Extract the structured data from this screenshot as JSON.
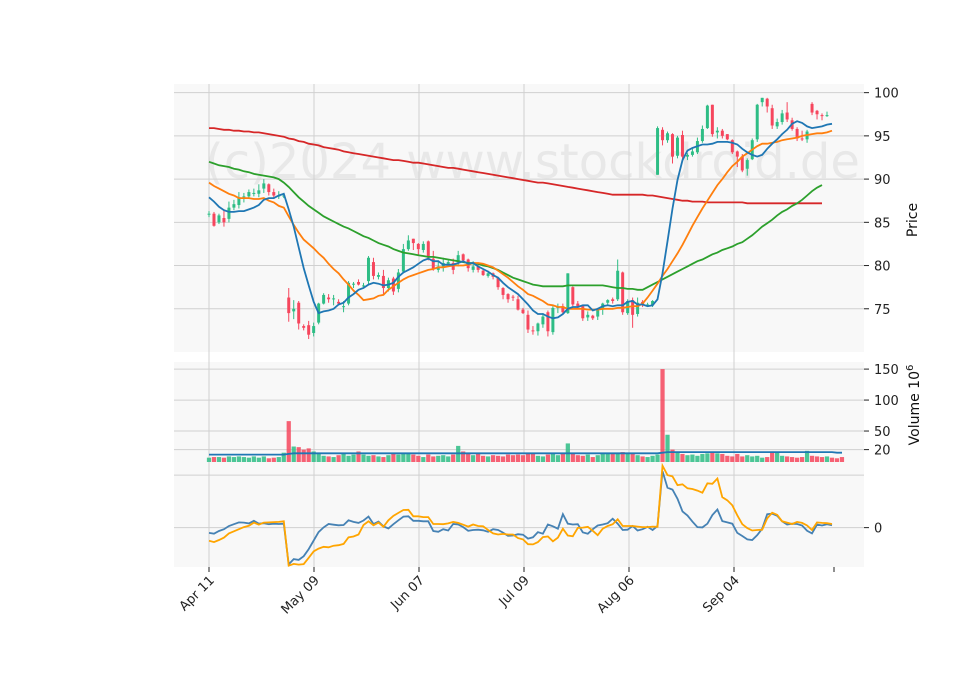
{
  "watermark": "(c)2024 www.stockdroid.de",
  "colors": {
    "up": "#2ebd85",
    "down": "#f6465d",
    "ma_fast": "#1f77b4",
    "ma_mid": "#ff7f0e",
    "ma_slow": "#2ca02c",
    "ma_long": "#d62728",
    "osc_a": "#4682b4",
    "osc_b": "#ffa500",
    "grid": "#d0d0d0",
    "panel_bg": "#f8f8f8"
  },
  "chart_data": {
    "type": "candlestick",
    "x_ticks": [
      "Apr 11",
      "May 09",
      "Jun 07",
      "Jul 09",
      "Aug 06",
      "Sep 04"
    ],
    "price_panel": {
      "ylabel": "Price",
      "ylim": [
        70,
        101
      ],
      "yticks": [
        75,
        80,
        85,
        90,
        95,
        100
      ],
      "candles_compact": "86,86,85.6,86.3|86,84.6,84.5,86.2|85,85.8,84.8,86|85.5,85,84.5,86.5|85.4,86.7,85,87.4|86.7,87.1,86.4,87.6|87,87.9,86.6,88.5|87.9,88,87.3,88.4|88,88.5,87.7,88.8|88.4,88.4,88,88.9|88.3,88.7,87.9,89.4|88.9,89.5,88.4,90|89.4,88.5,88.1,89.5|88.5,88.1,87.8,88.9|88.1,88.1,87.7,88.6|88.1,88.1,87.8,88.4|76.3,74.5,73.5,77.4|74.7,75,73.8,76|75.7,73.3,72.6,75.9|73,72.8,72.5,73.2|73.1,72,71.5,73.6|72.2,73,71.8,73.4|73.4,75.6,73.2,75.7|75.6,76.6,75.5,76.8|76.3,76.1,75.7,76.7|76.1,76.2,75.4,76.6|75.8,75.6,75.4,76.1|75.3,75.3,74.6,75.9|75.6,78,75.4,78.2|77.8,77.9,77.4,78.1|78.1,77.8,77.7,78.4|77.6,77.7,77.5,78|78.2,80.9,77.7,81.1|80.4,78.8,78.4,80.9|78.7,78.9,78.4,79.2|78.8,77.4,76.6,79.5|77.4,78.3,77,78.6|78.5,77,76.6,78.7|77.3,79.2,76.9,79.6|79.3,81.9,79.1,82.5|81.9,82.9,81.7,83.5|83.1,82.6,81.8,83.1|82.5,81.9,81.1,82.6|81.8,82.5,81.5,82.8|82.8,80.9,80.6,82.9|80.8,79.6,79.4,81.7|79.5,79.9,79.2,80.6|79.9,80.3,79.3,80.9|80.2,80.4,79.9,80.6|80.3,79.5,79,80.8|80.4,81.2,79.9,81.7|81.3,80.6,80.4,81.4|80.7,79.7,79.3,80.8|79.5,79.9,79.2,80.5|79.9,79.5,79.2,80.3|79.4,78.9,78.8,79.6|78.8,79.1,78.6,79.4|79.1,78.7,78.4,79.2|78.6,77.5,77.2,78.7|77.4,76.6,76.1,77.5|76.7,76.1,75.7,76.8|76.4,76.3,75.9,76.6|76.1,74.9,74.8,76.5|74.9,74.5,74.4,75.1|74.3,72.6,72.2,74.8|72.5,72.4,72,73|72.4,73.3,71.9,73.4|73.2,74.1,72.8,74.5|74.6,72.4,71.8,74.8|72.3,75.1,72,75.3|75.1,75.2,74.5,75.6|75.3,74.6,74.4,75.6|74.5,79.1,74.4,79.1|77.5,75.5,75.3,77.6|75.6,75.3,75,75.9|75.3,73.9,73.6,75.4|74,74.3,73.6,74.7|74.2,73.9,73.7,74.3|74.1,74.9,73.7,75.1|74.9,75.6,74.3,75.7|75.7,76,75.5,76.1|76.1,75.9,75.6,76.3|76.1,79.4,75.9,80.7|79.2,74.6,74.3,79.3|74.5,75.9,74.3,76.1|76,74.3,72.8,76.3|74.4,75.7,74.1,76.3|75.8,75.5,75.2,76|75.5,75.5,75.3,75.7|75.4,75.9,75.2,76|90.5,95.9,90.5,96.1|95.7,94.5,93.9,96|94.5,95.3,94.2,95.5|95.2,92.6,91.8,95.3|92.7,94.8,92.4,95|95.1,92.6,92.2,95.6|92.6,92.8,92.2,93|92.8,93.2,92.6,93.5|93.1,94.4,92.9,94.8|94.4,95.8,94.2,96.2|95.9,98.5,95.8,98.6|98.6,95.2,94.9,98.6|95.4,95.6,94.7,96|95.6,95,94.7,95.8|95.2,94.6,94.5,95.2|94.5,93.1,92.9,94.6|93.2,92.6,91.4,93.3|92.6,91,90.8,92.9|91.2,92.2,90.4,92.4|92.3,94.5,92.2,94.7|94.6,98.6,94.3,98.7|98.9,99.4,98.4,99.4|99.3,98.4,97.7,99.4|98.2,96.2,95.8,98.6|96.1,96.6,95.8,97|96.6,97.6,96.3,98|97.7,96.9,96.6,98.9|96.8,95.8,95.6,97.1|95.8,94.7,94.4,96|94.7,94.6,94.4,95.6|94.6,95.5,94.2,95.7|98.7,97.7,97.4,98.9|97.9,97.5,96.9,98|97.4,97.3,96.8,97.6|97.3,97.4,97.2,97.8",
      "ma_fast": [
        87.9,
        87.4,
        86.8,
        86.4,
        86.2,
        86.2,
        86.3,
        86.3,
        86.5,
        86.7,
        87,
        87.6,
        87.8,
        87.8,
        88.1,
        88.3,
        86.5,
        84.5,
        82.1,
        79.7,
        77.7,
        75.8,
        74.5,
        74.7,
        74.8,
        75,
        75.5,
        75.7,
        76.3,
        76.7,
        77.2,
        77.4,
        77.8,
        78,
        77.9,
        77.7,
        77.8,
        78,
        78.7,
        79.2,
        79.5,
        79.8,
        80.2,
        80.6,
        80.8,
        80.5,
        80.5,
        80.1,
        80.1,
        80.1,
        80.3,
        80.5,
        80.2,
        80.3,
        79.9,
        79.6,
        79.3,
        78.9,
        78.6,
        78,
        77.5,
        77.1,
        76.7,
        76.1,
        75.5,
        74.8,
        74.4,
        74.4,
        74.1,
        73.9,
        74,
        74.4,
        75,
        75.2,
        75.2,
        75.4,
        75.4,
        74.8,
        75,
        75.3,
        75.4,
        75.3,
        75.4,
        75.4,
        75.8,
        75.9,
        75.5,
        75.5,
        75.3,
        75.4,
        76.1,
        79.1,
        82.8,
        86.6,
        89.9,
        92.2,
        93.3,
        93.6,
        93.8,
        94,
        94,
        94.1,
        94.3,
        94.3,
        94.3,
        94.2,
        94,
        93.5,
        93.1,
        92.8,
        92.6,
        92.8,
        93.5,
        94.1,
        94.6,
        95.2,
        95.7,
        96.4,
        96.7,
        96.5,
        96.1,
        95.9,
        96,
        96.1,
        96.3,
        96.4
      ],
      "ma_mid": [
        89.6,
        89.2,
        88.9,
        88.6,
        88.3,
        88.1,
        87.8,
        87.8,
        87.8,
        87.7,
        87.7,
        87.8,
        87.5,
        87.3,
        86.9,
        86.7,
        85.7,
        84.7,
        83.8,
        83,
        82.5,
        82,
        81.4,
        80.9,
        80.2,
        79.6,
        79.1,
        78.4,
        77.8,
        77.1,
        76.6,
        76,
        76.1,
        76.2,
        76.5,
        76.6,
        77.2,
        77.6,
        78,
        78.4,
        78.7,
        78.9,
        79.1,
        79.3,
        79.5,
        79.6,
        79.8,
        79.8,
        79.9,
        80,
        80,
        80,
        80.1,
        80.3,
        80.3,
        80.2,
        80,
        79.8,
        79.4,
        79,
        78.6,
        78.1,
        77.6,
        77.2,
        76.7,
        76.5,
        76.2,
        75.9,
        75.5,
        75.4,
        75.2,
        75.2,
        75,
        75,
        75,
        75,
        74.9,
        74.9,
        74.9,
        75,
        75,
        75,
        75.1,
        75.1,
        75.2,
        75.3,
        75.3,
        75.6,
        76.3,
        77.1,
        77.9,
        78.8,
        79.6,
        80.5,
        81.4,
        82.4,
        83.5,
        84.6,
        85.6,
        86.6,
        87.5,
        88.4,
        89.3,
        90,
        90.8,
        91.5,
        92,
        92.6,
        93,
        93.4,
        93.8,
        94.1,
        94.1,
        94.2,
        94.3,
        94.5,
        94.6,
        94.7,
        94.8,
        95,
        95.1,
        95.2,
        95.3,
        95.3,
        95.4,
        95.6
      ],
      "ma_slow": [
        92,
        91.8,
        91.6,
        91.5,
        91.4,
        91.2,
        91.1,
        90.9,
        90.8,
        90.6,
        90.5,
        90.4,
        90.3,
        90.2,
        90,
        89.6,
        89.1,
        88.5,
        87.9,
        87.4,
        86.9,
        86.5,
        86.1,
        85.7,
        85.4,
        85.1,
        84.8,
        84.5,
        84.3,
        84,
        83.7,
        83.4,
        83.2,
        82.9,
        82.6,
        82.4,
        82.2,
        81.9,
        81.7,
        81.5,
        81.4,
        81.3,
        81.2,
        81.1,
        81,
        81,
        80.9,
        80.8,
        80.7,
        80.6,
        80.5,
        80.4,
        80.3,
        80.3,
        80.2,
        80,
        79.9,
        79.7,
        79.5,
        79.2,
        78.9,
        78.6,
        78.4,
        78.2,
        78,
        77.8,
        77.7,
        77.6,
        77.6,
        77.6,
        77.6,
        77.6,
        77.7,
        77.7,
        77.7,
        77.7,
        77.7,
        77.7,
        77.7,
        77.7,
        77.6,
        77.5,
        77.4,
        77.4,
        77.3,
        77.3,
        77.2,
        77.2,
        77.5,
        77.8,
        78.1,
        78.4,
        78.7,
        79,
        79.3,
        79.6,
        79.9,
        80.2,
        80.5,
        80.7,
        81,
        81.3,
        81.5,
        81.8,
        82,
        82.2,
        82.5,
        82.7,
        83.1,
        83.5,
        84,
        84.5,
        84.9,
        85.3,
        85.8,
        86.2,
        86.5,
        86.9,
        87.2,
        87.6,
        88.1,
        88.6,
        89,
        89.3
      ],
      "ma_long": [
        95.9,
        95.9,
        95.8,
        95.7,
        95.7,
        95.6,
        95.6,
        95.5,
        95.5,
        95.4,
        95.4,
        95.3,
        95.2,
        95.1,
        95,
        94.9,
        94.7,
        94.6,
        94.4,
        94.3,
        94.1,
        94,
        93.9,
        93.7,
        93.6,
        93.5,
        93.4,
        93.2,
        93.1,
        93,
        92.9,
        92.8,
        92.7,
        92.6,
        92.5,
        92.4,
        92.3,
        92.2,
        92.2,
        92.1,
        92,
        91.9,
        91.9,
        91.8,
        91.7,
        91.6,
        91.5,
        91.4,
        91.3,
        91.3,
        91.2,
        91.1,
        91,
        90.9,
        90.8,
        90.7,
        90.6,
        90.5,
        90.4,
        90.3,
        90.2,
        90.1,
        90,
        89.9,
        89.8,
        89.7,
        89.6,
        89.6,
        89.5,
        89.4,
        89.3,
        89.2,
        89.1,
        89,
        88.9,
        88.8,
        88.7,
        88.6,
        88.5,
        88.4,
        88.3,
        88.2,
        88.2,
        88.2,
        88.2,
        88.2,
        88.2,
        88.2,
        88.1,
        88.1,
        88,
        87.9,
        87.8,
        87.7,
        87.6,
        87.5,
        87.5,
        87.4,
        87.4,
        87.4,
        87.3,
        87.3,
        87.3,
        87.3,
        87.3,
        87.3,
        87.3,
        87.3,
        87.2,
        87.2,
        87.2,
        87.2,
        87.2,
        87.2,
        87.2,
        87.2,
        87.2,
        87.2,
        87.2,
        87.2,
        87.2,
        87.2,
        87.2,
        87.2
      ]
    },
    "volume_panel": {
      "ylabel": "Volume  10^6",
      "ylim": [
        0,
        155
      ],
      "yticks": [
        20,
        50,
        100,
        150
      ],
      "volumes": [
        7,
        8,
        8,
        7,
        9,
        8,
        9,
        8,
        7,
        9,
        7,
        9,
        6,
        7,
        8,
        15,
        66,
        25,
        24,
        20,
        22,
        17,
        13,
        10,
        9,
        8,
        11,
        13,
        10,
        12,
        17,
        12,
        10,
        11,
        9,
        8,
        11,
        13,
        12,
        13,
        14,
        12,
        10,
        8,
        12,
        9,
        10,
        11,
        9,
        12,
        26,
        17,
        14,
        11,
        13,
        10,
        9,
        11,
        10,
        9,
        12,
        11,
        12,
        11,
        13,
        15,
        10,
        9,
        12,
        13,
        11,
        14,
        30,
        15,
        11,
        10,
        12,
        8,
        11,
        14,
        13,
        14,
        15,
        16,
        13,
        14,
        11,
        9,
        8,
        10,
        12,
        150,
        44,
        20,
        16,
        13,
        11,
        12,
        10,
        13,
        14,
        16,
        14,
        13,
        10,
        9,
        13,
        9,
        11,
        9,
        10,
        7,
        8,
        17,
        15,
        10,
        9,
        8,
        7,
        8,
        18,
        10,
        9,
        8,
        9,
        7,
        6,
        8
      ],
      "volume_ma": [
        12,
        12,
        12,
        12,
        12,
        12,
        12,
        12,
        12,
        12,
        12,
        12,
        12,
        12,
        12,
        12,
        13,
        14,
        14,
        14,
        14,
        14,
        14,
        14,
        14,
        14,
        14,
        14,
        14,
        14,
        14,
        14,
        14,
        14,
        14,
        14,
        14,
        14,
        14,
        14,
        14,
        14,
        14,
        14,
        14,
        14,
        14,
        14,
        14,
        14,
        14,
        14,
        14,
        14,
        14,
        14,
        14,
        14,
        14,
        14,
        14,
        14,
        14,
        14,
        14,
        14,
        14,
        14,
        14,
        14,
        14,
        14,
        14,
        14,
        14,
        14,
        14,
        14,
        14,
        14,
        14,
        14,
        14,
        14,
        14,
        14,
        14,
        14,
        14,
        14,
        14,
        15,
        16,
        16,
        16,
        16,
        16,
        16,
        16,
        16,
        16,
        16,
        16,
        16,
        16,
        16,
        16,
        16,
        16,
        16,
        16,
        16,
        16,
        16,
        16,
        16,
        16,
        16,
        16,
        16,
        16,
        16,
        16,
        16,
        16,
        16,
        15,
        15
      ]
    },
    "oscillator_panel": {
      "ylim": [
        -15,
        25
      ],
      "yticks": [
        0,
        20
      ],
      "series_a": [
        -2,
        -2.3,
        -1.3,
        -0.6,
        0.6,
        1.3,
        2,
        1.9,
        1.6,
        2.6,
        1.5,
        1.7,
        1.3,
        1.5,
        1.4,
        1.5,
        -14,
        -12,
        -12.3,
        -10.9,
        -8.2,
        -4.9,
        -1.7,
        0.1,
        1.4,
        1.1,
        0.9,
        1,
        2.8,
        2.2,
        1.8,
        2.7,
        4.2,
        1.4,
        2.3,
        0.5,
        -0.3,
        1.3,
        2.8,
        4.2,
        4.3,
        2.6,
        2.6,
        2.4,
        2.4,
        -1.3,
        -1.6,
        -0.6,
        -1.1,
        1.4,
        1.2,
        0.2,
        -1.2,
        -0.9,
        -0.8,
        -1,
        -1.6,
        -0.6,
        -0.9,
        -1.9,
        -3.1,
        -3,
        -2.5,
        -2.7,
        -4.2,
        -3.7,
        -1.7,
        -2.3,
        1.2,
        0.5,
        -0.4,
        5.1,
        1.5,
        1.2,
        1.3,
        -1.8,
        -2.3,
        -0.6,
        0.8,
        1.2,
        1.7,
        3.4,
        1.5,
        -0.9,
        -0.8,
        0.6,
        -1.1,
        -0.6,
        0.3,
        -0.9,
        0.6,
        21.5,
        15.2,
        14.5,
        11,
        6.2,
        4.6,
        2.3,
        0.2,
        0.1,
        1.5,
        4.8,
        6.9,
        2.5,
        2,
        1.5,
        -2,
        -3.2,
        -4.5,
        -4.7,
        -2.9,
        -0.4,
        5.1,
        5.3,
        4.5,
        2.4,
        1.2,
        1.5,
        1.4,
        0.8,
        -1.2,
        -2.2,
        1.2,
        0.8,
        1.3,
        0.9
      ],
      "series_b": [
        -5,
        -5.5,
        -4.7,
        -3.8,
        -2.2,
        -1.4,
        -0.6,
        0.2,
        0.7,
        1.9,
        1.1,
        1.9,
        2,
        2.1,
        2.2,
        2.4,
        -14.5,
        -13.8,
        -14.1,
        -13.9,
        -11.5,
        -9,
        -8,
        -7.3,
        -7.5,
        -6.9,
        -6.7,
        -6.2,
        -3.7,
        -3.4,
        -2.6,
        1,
        2.4,
        0.9,
        1.9,
        0.3,
        2.8,
        4.5,
        5.6,
        6.7,
        6.8,
        4.3,
        4.3,
        4,
        4,
        1.4,
        1.4,
        1.3,
        1.6,
        2.2,
        1.8,
        1.1,
        0.4,
        1.2,
        0.6,
        0.5,
        -0.9,
        -2.2,
        -2.6,
        -2.4,
        -2.6,
        -2.6,
        -4,
        -4.5,
        -6.3,
        -6.4,
        -5.5,
        -3.6,
        -3.4,
        -5.2,
        -3.8,
        -0.4,
        -3,
        -3.3,
        -0.1,
        0,
        0.3,
        -1.2,
        -2.9,
        -0.4,
        0.6,
        1.3,
        3.2,
        0.6,
        0.6,
        0.6,
        0.4,
        0.2,
        0.2,
        0.4,
        0.3,
        23.6,
        20,
        19.5,
        16.2,
        16.5,
        15,
        14.7,
        14.1,
        13.3,
        16.9,
        16.7,
        18.7,
        11.6,
        10.4,
        8.5,
        4.7,
        1.3,
        -0.2,
        -1.1,
        -0.9,
        -0.8,
        3.5,
        5.7,
        4.9,
        2.4,
        1.9,
        1.4,
        2.2,
        1.8,
        0.8,
        -0.9,
        2,
        1.8,
        1.7,
        1.4
      ]
    }
  }
}
